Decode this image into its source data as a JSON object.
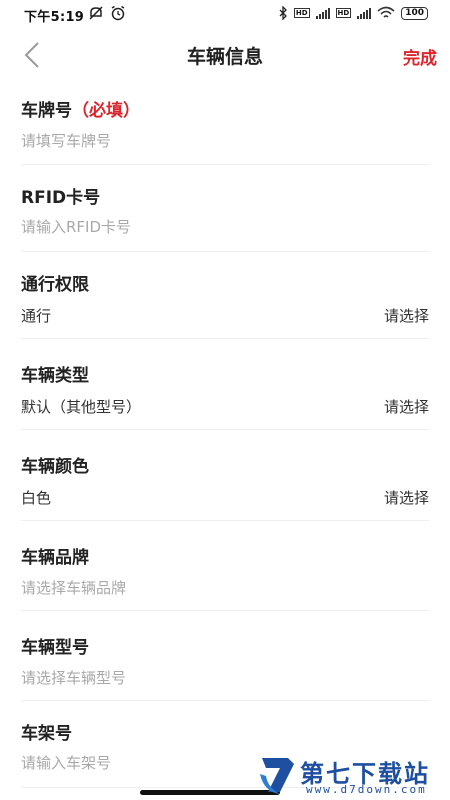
{
  "status_bar": {
    "time": "下午5:19",
    "left_icons": [
      "mute-icon",
      "alarm-icon"
    ],
    "right_icons": [
      "bluetooth-icon",
      "signal-icon",
      "signal-icon",
      "wifi-icon"
    ],
    "hd_label": "HD",
    "battery": "100"
  },
  "header": {
    "title": "车辆信息",
    "done_label": "完成",
    "back_icon": "chevron-left-icon"
  },
  "colors": {
    "accent": "#d9262c",
    "placeholder": "#a9a9a9",
    "divider": "#eeeeee",
    "watermark": "#1f4fa0"
  },
  "fields": [
    {
      "label": "车牌号",
      "required_note": "（必填）",
      "placeholder": "请填写车牌号"
    },
    {
      "label": "RFID卡号",
      "placeholder": "请输入RFID卡号"
    },
    {
      "label": "通行权限",
      "value": "通行",
      "action": "请选择"
    },
    {
      "label": "车辆类型",
      "value": "默认（其他型号）",
      "action": "请选择"
    },
    {
      "label": "车辆颜色",
      "value": "白色",
      "action": "请选择"
    },
    {
      "label": "车辆品牌",
      "placeholder": "请选择车辆品牌"
    },
    {
      "label": "车辆型号",
      "placeholder": "请选择车辆型号"
    },
    {
      "label": "车架号",
      "placeholder": "请输入车架号"
    }
  ],
  "watermark": {
    "text": "第七下载站",
    "url": "www.d7down.com"
  }
}
